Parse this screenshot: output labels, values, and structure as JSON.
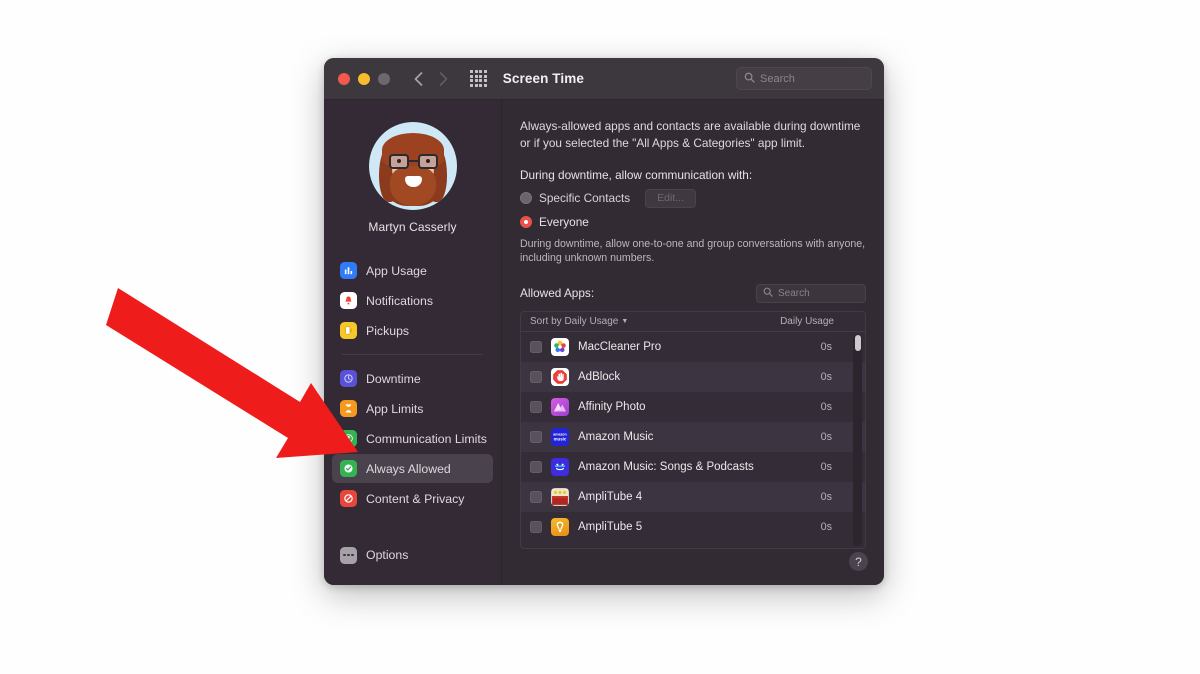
{
  "window": {
    "title": "Screen Time",
    "traffic_lights": [
      "close-red",
      "minimize-yellow",
      "zoom-disabled-gray"
    ],
    "search": {
      "placeholder": "Search",
      "value": ""
    },
    "nav": {
      "back": "back-chevron",
      "forward": "forward-chevron"
    },
    "grid_icon": "app-grid-icon"
  },
  "sidebar": {
    "user": {
      "name": "Martyn Casserly",
      "avatar": "memoji-avatar"
    },
    "groups": [
      {
        "items": [
          {
            "label": "App Usage",
            "icon": "app-usage-icon",
            "color": "#2f7cf6",
            "glyph": "▮▮▮",
            "active": false
          },
          {
            "label": "Notifications",
            "icon": "notifications-icon",
            "color": "#ffffff",
            "glyph": "🔔",
            "active": false
          },
          {
            "label": "Pickups",
            "icon": "pickups-icon",
            "color": "#f5c828",
            "glyph": "✋",
            "active": false
          }
        ]
      },
      {
        "items": [
          {
            "label": "Downtime",
            "icon": "downtime-icon",
            "color": "#5a52d6",
            "glyph": "◔",
            "active": false
          },
          {
            "label": "App Limits",
            "icon": "app-limits-icon",
            "color": "#f59a1f",
            "glyph": "⧗",
            "active": false
          },
          {
            "label": "Communication Limits",
            "icon": "communication-limits-icon",
            "color": "#34b352",
            "glyph": "◉",
            "active": false
          },
          {
            "label": "Always Allowed",
            "icon": "always-allowed-icon",
            "color": "#34b352",
            "glyph": "✓",
            "active": true
          },
          {
            "label": "Content & Privacy",
            "icon": "content-privacy-icon",
            "color": "#e8453c",
            "glyph": "⃠",
            "active": false
          }
        ]
      }
    ],
    "options": {
      "label": "Options",
      "icon": "options-ellipsis-icon"
    }
  },
  "main": {
    "intro": "Always-allowed apps and contacts are available during downtime or if you selected the \"All Apps & Categories\" app limit.",
    "communication_question": "During downtime, allow communication with:",
    "radios": [
      {
        "label": "Specific Contacts",
        "selected": false
      },
      {
        "label": "Everyone",
        "selected": true
      }
    ],
    "edit_button": "Edit...",
    "everyone_note": "During downtime, allow one-to-one and group conversations with anyone, including unknown numbers.",
    "allowed_apps_label": "Allowed Apps:",
    "apps_search": {
      "placeholder": "Search",
      "value": ""
    },
    "table": {
      "sort_label": "Sort by Daily Usage",
      "sort_chevron": "chevron-down-icon",
      "usage_column": "Daily Usage",
      "rows": [
        {
          "name": "MacCleaner Pro",
          "usage": "0s",
          "checked": false,
          "icon": "maccleaner-pro-icon",
          "icon_bg": "#ffffff",
          "glyph": "✻"
        },
        {
          "name": "AdBlock",
          "usage": "0s",
          "checked": false,
          "icon": "adblock-icon",
          "icon_bg": "#e8312a",
          "glyph": "✋"
        },
        {
          "name": "Affinity Photo",
          "usage": "0s",
          "checked": false,
          "icon": "affinity-photo-icon",
          "icon_bg": "#c14bd8",
          "glyph": "◺"
        },
        {
          "name": "Amazon Music",
          "usage": "0s",
          "checked": false,
          "icon": "amazon-music-icon",
          "icon_bg": "#2323d8",
          "glyph": "♪"
        },
        {
          "name": "Amazon Music: Songs & Podcasts",
          "usage": "0s",
          "checked": false,
          "icon": "amazon-music-songs-icon",
          "icon_bg": "#3d2ce0",
          "glyph": "☻"
        },
        {
          "name": "AmpliTube 4",
          "usage": "0s",
          "checked": false,
          "icon": "amplitube-4-icon",
          "icon_bg": "#c8332c",
          "glyph": "▦"
        },
        {
          "name": "AmpliTube 5",
          "usage": "0s",
          "checked": false,
          "icon": "amplitube-5-icon",
          "icon_bg": "#f0a41e",
          "glyph": "◈"
        }
      ]
    },
    "help_button": "?"
  },
  "annotation": {
    "arrow": "red-pointer-arrow",
    "color": "#ef1c1c",
    "points_to": "Always Allowed"
  }
}
